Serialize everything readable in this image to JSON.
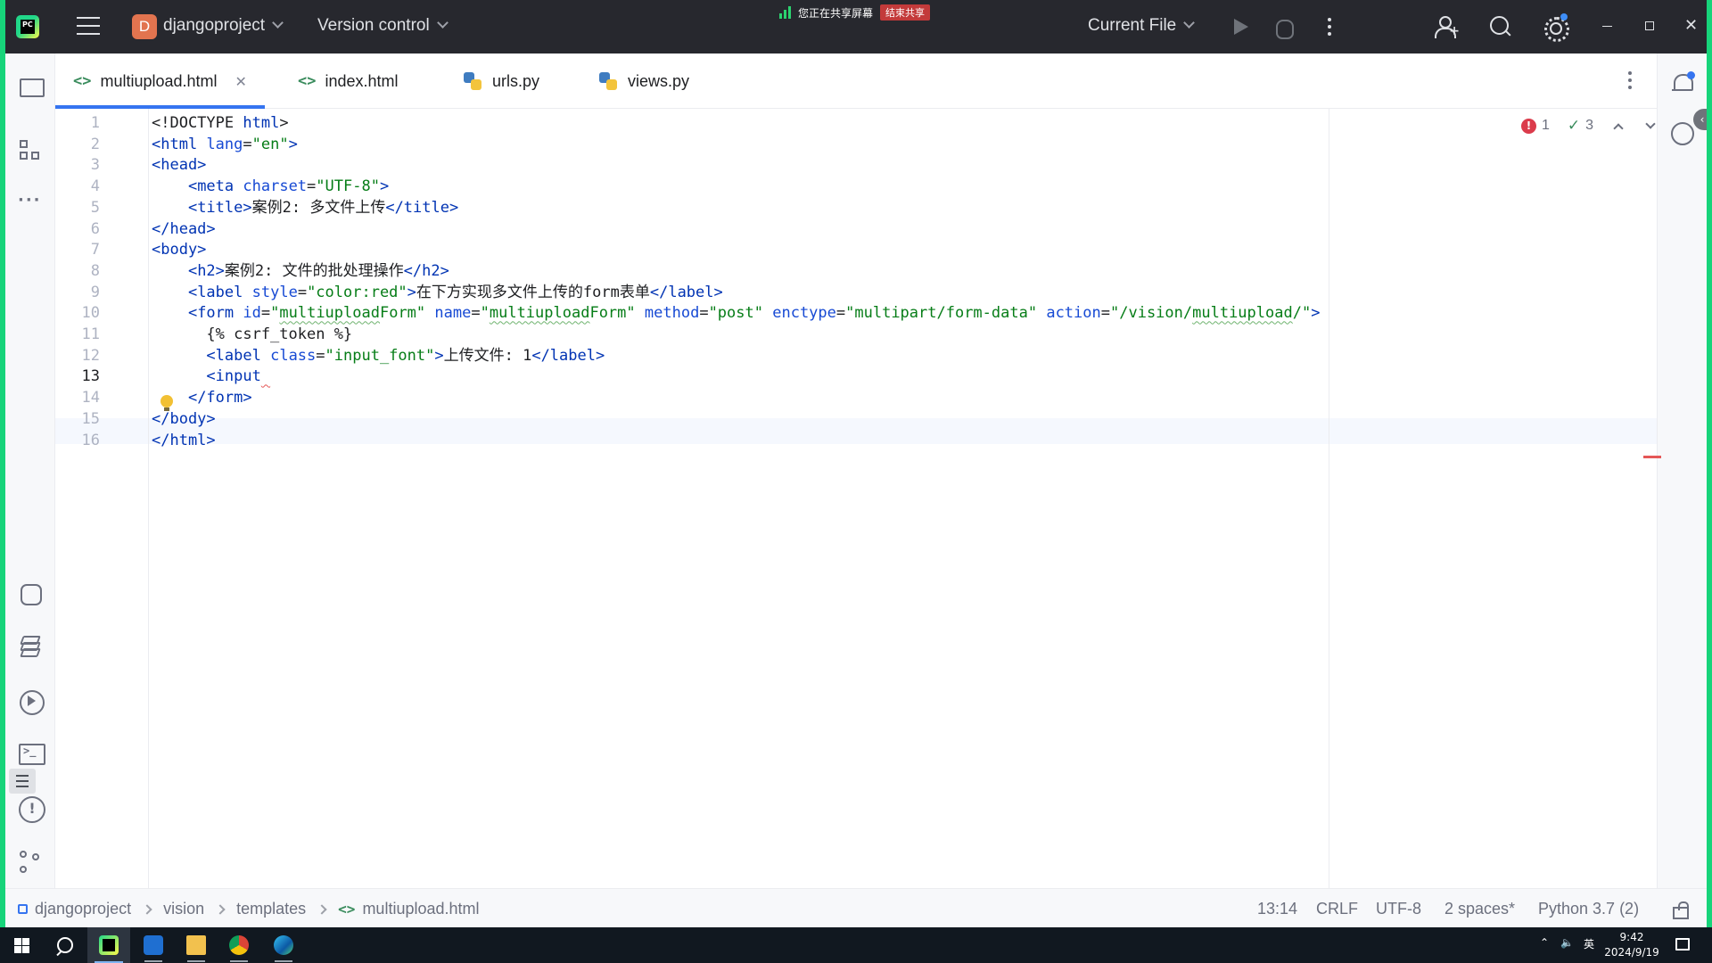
{
  "app": {
    "project_initial": "D",
    "project_name": "djangoproject",
    "version_control": "Version control",
    "run_config": "Current File",
    "logo_text": "PC"
  },
  "screen_share": {
    "status": "您正在共享屏幕",
    "stop_label": "结束共享"
  },
  "tabs": [
    {
      "label": "multiupload.html",
      "type": "html",
      "active": true,
      "closable": true
    },
    {
      "label": "index.html",
      "type": "html",
      "active": false
    },
    {
      "label": "urls.py",
      "type": "python",
      "active": false
    },
    {
      "label": "views.py",
      "type": "python",
      "active": false
    }
  ],
  "inspections": {
    "errors": "1",
    "weak_warnings": "3"
  },
  "code_lines": [
    {
      "n": "1",
      "html": "&lt;!DOCTYPE <span class='tg'>html</span>&gt;"
    },
    {
      "n": "2",
      "html": "<span class='tg'>&lt;html</span> <span class='at'>lang</span>=<span class='vl'>\"en\"</span><span class='tg'>&gt;</span>"
    },
    {
      "n": "3",
      "html": "<span class='tg'>&lt;head&gt;</span>"
    },
    {
      "n": "4",
      "html": "    <span class='tg'>&lt;meta</span> <span class='at'>charset</span>=<span class='vl'>\"UTF-8\"</span><span class='tg'>&gt;</span>"
    },
    {
      "n": "5",
      "html": "    <span class='tg'>&lt;title&gt;</span>案例2: 多文件上传<span class='tg'>&lt;/title&gt;</span>"
    },
    {
      "n": "6",
      "html": "<span class='tg'>&lt;/head&gt;</span>"
    },
    {
      "n": "7",
      "html": "<span class='tg'>&lt;body&gt;</span>"
    },
    {
      "n": "8",
      "html": "    <span class='tg'>&lt;h2&gt;</span>案例2: 文件的批处理操作<span class='tg'>&lt;/h2&gt;</span>"
    },
    {
      "n": "9",
      "html": "    <span class='tg'>&lt;label</span> <span class='at'>style</span>=<span class='vl'>\"color:red\"</span><span class='tg'>&gt;</span>在下方实现多文件上传的form表单<span class='tg'>&lt;/label&gt;</span>"
    },
    {
      "n": "10",
      "html": "    <span class='tg'>&lt;form</span> <span class='at'>id</span>=<span class='vl'>\"<span class='typo'>multiupload</span>Form\"</span> <span class='at'>name</span>=<span class='vl'>\"<span class='typo'>multiupload</span>Form\"</span> <span class='at'>method</span>=<span class='vl'>\"post\"</span> <span class='at'>enctype</span>=<span class='vl'>\"multipart/form-data\"</span> <span class='at'>action</span>=<span class='vl'>\"/vision/<span class='typo'>multiupload</span>/\"</span><span class='tg'>&gt;</span>"
    },
    {
      "n": "11",
      "html": "      {% csrf_token %}"
    },
    {
      "n": "12",
      "html": "      <span class='tg'>&lt;label</span> <span class='at'>class</span>=<span class='vl'>\"input_font\"</span><span class='tg'>&gt;</span>上传文件: 1<span class='tg'>&lt;/label&gt;</span>"
    },
    {
      "n": "13",
      "html": "      <span class='tg'>&lt;input</span><span class='err'> </span>"
    },
    {
      "n": "14",
      "html": "    <span class='tg'>&lt;/form&gt;</span>"
    },
    {
      "n": "15",
      "html": "<span class='tg'>&lt;/body&gt;</span>"
    },
    {
      "n": "16",
      "html": "<span class='tg'>&lt;/html&gt;</span>"
    }
  ],
  "breadcrumb": [
    "djangoproject",
    "vision",
    "templates",
    "multiupload.html"
  ],
  "status": {
    "position": "13:14",
    "line_sep": "CRLF",
    "encoding": "UTF-8",
    "indent": "2 spaces*",
    "interpreter": "Python 3.7 (2)"
  },
  "taskbar": {
    "ime": "英",
    "time": "9:42",
    "date": "2024/9/19"
  },
  "colors": {
    "accent": "#3574f0",
    "titlebar": "#27282e",
    "error": "#db3b4b",
    "share_border": "#17d47a"
  }
}
